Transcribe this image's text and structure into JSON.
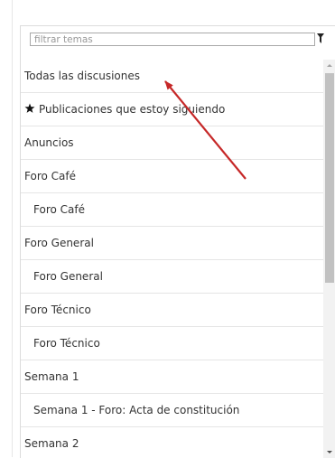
{
  "filter": {
    "placeholder": "filtrar temas"
  },
  "icons": {
    "filter": "filter-icon",
    "star": "star-icon"
  },
  "colors": {
    "annotation_arrow": "#c62828"
  },
  "topics": [
    {
      "label": "Todas las discusiones",
      "level": 0
    },
    {
      "label": "Publicaciones que estoy siguiendo",
      "level": 0,
      "icon": "star-icon"
    },
    {
      "label": "Anuncios",
      "level": 0
    },
    {
      "label": "Foro Café",
      "level": 0
    },
    {
      "label": "Foro Café",
      "level": 1
    },
    {
      "label": "Foro General",
      "level": 0
    },
    {
      "label": "Foro General",
      "level": 1
    },
    {
      "label": "Foro Técnico",
      "level": 0
    },
    {
      "label": "Foro Técnico",
      "level": 1
    },
    {
      "label": "Semana 1",
      "level": 0
    },
    {
      "label": "Semana 1 - Foro: Acta de constitución",
      "level": 1
    },
    {
      "label": "Semana 2",
      "level": 0
    }
  ]
}
